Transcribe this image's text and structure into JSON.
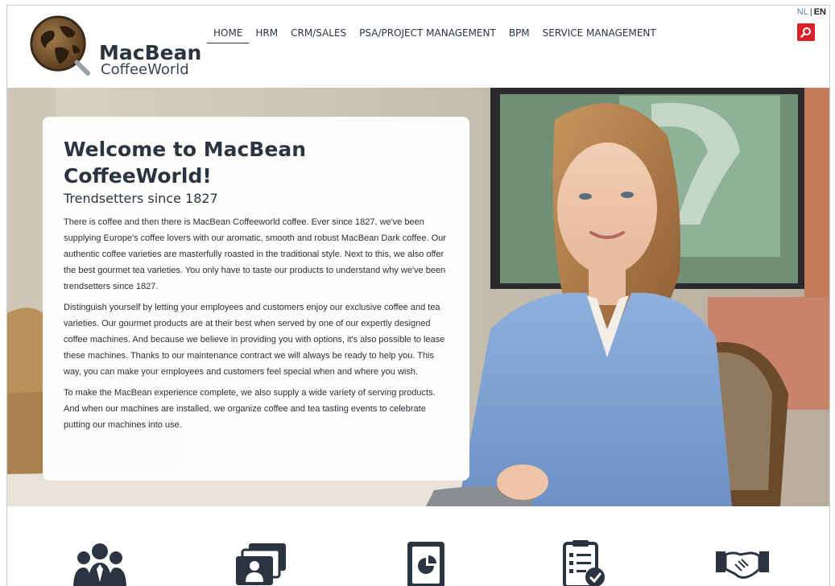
{
  "brand": {
    "name_line1": "MacBean",
    "name_line2": "CoffeeWorld"
  },
  "nav": {
    "items": [
      {
        "label": "HOME",
        "active": true
      },
      {
        "label": "HRM",
        "active": false
      },
      {
        "label": "CRM/SALES",
        "active": false
      },
      {
        "label": "PSA/PROJECT MANAGEMENT",
        "active": false
      },
      {
        "label": "BPM",
        "active": false
      },
      {
        "label": "SERVICE MANAGEMENT",
        "active": false
      }
    ]
  },
  "language": {
    "options": [
      "NL",
      "EN"
    ],
    "separator": "|",
    "selected": "EN"
  },
  "search": {
    "icon": "search-icon"
  },
  "hero": {
    "title": "Welcome to MacBean CoffeeWorld!",
    "subtitle": "Trendsetters since 1827",
    "paragraphs": [
      "There is coffee and then there is MacBean Coffeeworld coffee. Ever since 1827, we've been supplying Europe's coffee lovers with our aromatic, smooth and robust MacBean Dark coffee. Our authentic coffee varieties are masterfully roasted in the traditional style. Next to this, we also offer the best gourmet tea varieties. You only have to taste our products to understand why we've been trendsetters since 1827.",
      "Distinguish yourself by letting your employees and customers enjoy our exclusive coffee and tea varieties. Our gourmet products are at their best when served by one of our expertly designed coffee machines. And because we believe in providing you with options, it's also possible to lease these machines. Thanks to our maintenance contract we will always be ready to help you. This way, you can make your employees and customers feel special when and where you wish.",
      "To make the MacBean experience complete, we also supply a wide variety of serving products. And when our machines are installed, we organize coffee and tea tasting events to celebrate putting our machines into use."
    ]
  },
  "features": {
    "icons": [
      "team-icon",
      "contact-cards-icon",
      "document-chart-icon",
      "checklist-icon",
      "handshake-icon"
    ]
  },
  "colors": {
    "brand_dark": "#2b3542",
    "search_red": "#d6232a",
    "link_blue": "#5a7fb0"
  }
}
